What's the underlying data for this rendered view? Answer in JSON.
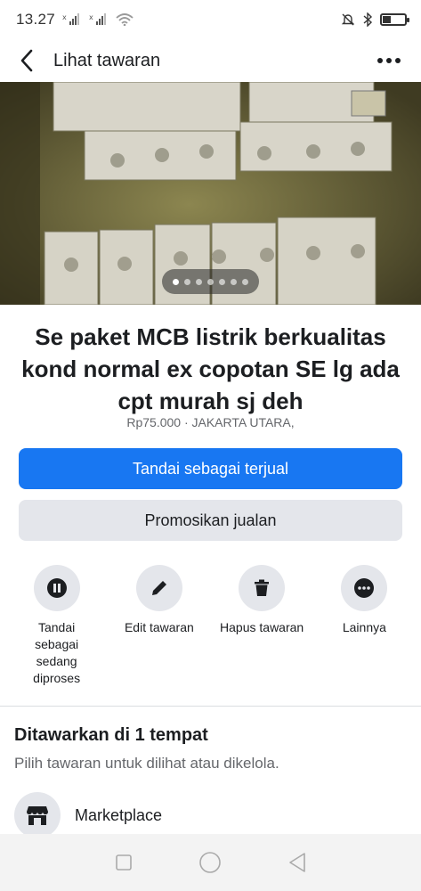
{
  "status_bar": {
    "time": "13.27",
    "signal_1_label": "x",
    "signal_2_label": "x",
    "battery_level": 0.35
  },
  "header": {
    "title": "Lihat tawaran",
    "back_icon": "back-arrow-icon",
    "more_icon": "more-horizontal-icon"
  },
  "photo": {
    "page_count": 7,
    "active_index": 0
  },
  "listing": {
    "title": "Se paket MCB listrik berkualitas kond normal ex copotan SE lg ada cpt murah sj deh",
    "subtitle": "Rp75.000 · JAKARTA UTARA,"
  },
  "buttons": {
    "mark_sold": "Tandai sebagai terjual",
    "promote": "Promosikan jualan"
  },
  "actions": [
    {
      "label": "Tandai sebagai sedang diproses",
      "icon": "pause-icon"
    },
    {
      "label": "Edit tawaran",
      "icon": "pencil-icon"
    },
    {
      "label": "Hapus tawaran",
      "icon": "trash-icon"
    },
    {
      "label": "Lainnya",
      "icon": "more-icon"
    }
  ],
  "section": {
    "title": "Ditawarkan di 1 tempat",
    "subtitle": "Pilih tawaran untuk dilihat atau dikelola."
  },
  "places": [
    {
      "label": "Marketplace",
      "icon": "marketplace-store-icon"
    }
  ],
  "colors": {
    "primary": "#1877f2",
    "secondary_bg": "#e4e6eb",
    "text": "#1c1e21",
    "muted": "#65676b"
  }
}
